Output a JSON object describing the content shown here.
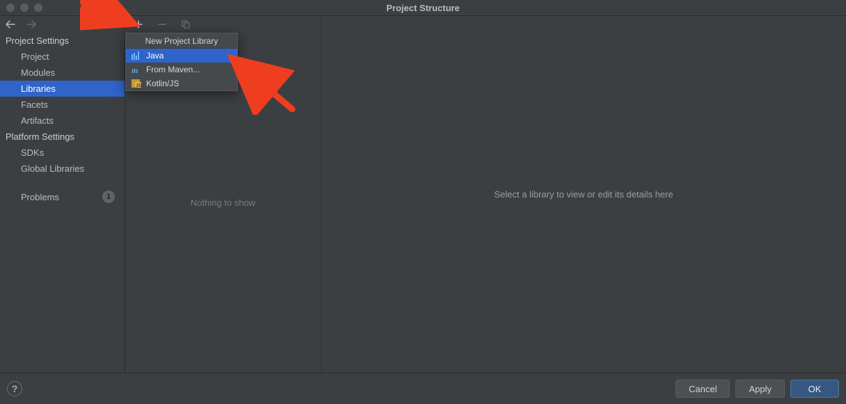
{
  "title": "Project Structure",
  "sidebar": {
    "section_project_settings": "Project Settings",
    "items_project": [
      "Project",
      "Modules",
      "Libraries",
      "Facets",
      "Artifacts"
    ],
    "section_platform_settings": "Platform Settings",
    "items_platform": [
      "SDKs",
      "Global Libraries"
    ],
    "problems_label": "Problems",
    "problems_count": "1"
  },
  "popup": {
    "title": "New Project Library",
    "items": [
      {
        "icon": "java",
        "label": "Java"
      },
      {
        "icon": "maven",
        "label": "From Maven..."
      },
      {
        "icon": "kotlin-js",
        "label": "Kotlin/JS"
      }
    ]
  },
  "middle": {
    "empty_text": "Nothing to show"
  },
  "detail": {
    "hint": "Select a library to view or edit its details here"
  },
  "buttons": {
    "cancel": "Cancel",
    "apply": "Apply",
    "ok": "OK",
    "help": "?"
  }
}
